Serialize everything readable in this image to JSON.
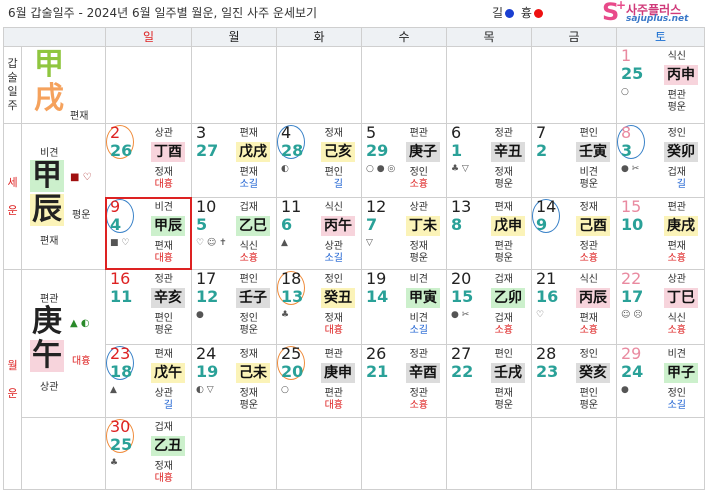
{
  "header": {
    "title": "6월 갑술일주 - 2024년 6월 일주별 월운, 일진 사주 운세보기",
    "legend_good": "길",
    "legend_bad": "흉",
    "logo_name": "사주플러스",
    "logo_url": "sajuplus.net",
    "logo_s": "S",
    "logo_plus": "+"
  },
  "colors": {
    "good": "#1a3fd1",
    "bad": "#e11"
  },
  "weekdays": [
    "일",
    "월",
    "화",
    "수",
    "목",
    "금",
    "토"
  ],
  "side": {
    "ilju_label": [
      "갑",
      "술",
      "일",
      "주"
    ],
    "seun_label": [
      "세",
      "운"
    ],
    "wolun_label": [
      "월",
      "운"
    ]
  },
  "ilju": {
    "top": "甲",
    "bottom": "戌",
    "tg": "편재"
  },
  "seun": {
    "tg_top": "비견",
    "top": "甲",
    "bottom": "辰",
    "tg_bottom": "편재",
    "note": "평운",
    "icons": "■ ♡"
  },
  "wolun": {
    "tg_top": "편관",
    "top": "庚",
    "bottom": "午",
    "tg_bottom": "상관",
    "note": "대흉",
    "icons": "▲ ◐"
  },
  "days": [
    {
      "d": "1",
      "l": "25",
      "t1": "식신",
      "g": "丙申",
      "gc": "pink",
      "t2": "편관",
      "f": "평운",
      "fc": "ok",
      "dc": "pink",
      "s": "○"
    },
    {
      "d": "2",
      "l": "26",
      "t1": "상관",
      "g": "丁酉",
      "gc": "pink",
      "t2": "정재",
      "f": "대흉",
      "fc": "bad",
      "dc": "red",
      "s": "",
      "c": "orange"
    },
    {
      "d": "3",
      "l": "27",
      "t1": "편재",
      "g": "戊戌",
      "gc": "yellow",
      "t2": "편재",
      "f": "소길",
      "fc": "good",
      "dc": "",
      "s": ""
    },
    {
      "d": "4",
      "l": "28",
      "t1": "정재",
      "g": "己亥",
      "gc": "yellow",
      "t2": "편인",
      "f": "길",
      "fc": "good",
      "dc": "",
      "s": "◐",
      "c": "blue"
    },
    {
      "d": "5",
      "l": "29",
      "t1": "편관",
      "g": "庚子",
      "gc": "gray",
      "t2": "정인",
      "f": "소흉",
      "fc": "bad",
      "dc": "",
      "s": "○ ● ◎"
    },
    {
      "d": "6",
      "l": "1",
      "t1": "정관",
      "g": "辛丑",
      "gc": "gray",
      "t2": "정재",
      "f": "평운",
      "fc": "ok",
      "dc": "",
      "s": "♣ ▽"
    },
    {
      "d": "7",
      "l": "2",
      "t1": "편인",
      "g": "壬寅",
      "gc": "gray",
      "t2": "비견",
      "f": "평운",
      "fc": "ok",
      "dc": "",
      "s": ""
    },
    {
      "d": "8",
      "l": "3",
      "t1": "정인",
      "g": "癸卯",
      "gc": "gray",
      "t2": "겁재",
      "f": "길",
      "fc": "good",
      "dc": "pink",
      "s": "● ✂",
      "c": "blue"
    },
    {
      "d": "9",
      "l": "4",
      "t1": "비견",
      "g": "甲辰",
      "gc": "green",
      "t2": "편재",
      "f": "대흉",
      "fc": "bad",
      "dc": "red",
      "s": "■ ♡",
      "c": "blue",
      "today": true
    },
    {
      "d": "10",
      "l": "5",
      "t1": "겁재",
      "g": "乙巳",
      "gc": "green",
      "t2": "식신",
      "f": "소흉",
      "fc": "bad",
      "dc": "",
      "s": "♡ ☺ ✝"
    },
    {
      "d": "11",
      "l": "6",
      "t1": "식신",
      "g": "丙午",
      "gc": "pink",
      "t2": "상관",
      "f": "소길",
      "fc": "good",
      "dc": "",
      "s": "▲"
    },
    {
      "d": "12",
      "l": "7",
      "t1": "상관",
      "g": "丁未",
      "gc": "yellow",
      "t2": "정재",
      "f": "평운",
      "fc": "ok",
      "dc": "",
      "s": "▽"
    },
    {
      "d": "13",
      "l": "8",
      "t1": "편재",
      "g": "戊申",
      "gc": "yellow",
      "t2": "편관",
      "f": "평운",
      "fc": "ok",
      "dc": "",
      "s": ""
    },
    {
      "d": "14",
      "l": "9",
      "t1": "정재",
      "g": "己酉",
      "gc": "yellow",
      "t2": "정관",
      "f": "소흉",
      "fc": "bad",
      "dc": "",
      "s": "",
      "c": "blue"
    },
    {
      "d": "15",
      "l": "10",
      "t1": "편관",
      "g": "庚戌",
      "gc": "yellow",
      "t2": "편재",
      "f": "소흉",
      "fc": "bad",
      "dc": "pink",
      "s": ""
    },
    {
      "d": "16",
      "l": "11",
      "t1": "정관",
      "g": "辛亥",
      "gc": "gray",
      "t2": "편인",
      "f": "평운",
      "fc": "ok",
      "dc": "red",
      "s": ""
    },
    {
      "d": "17",
      "l": "12",
      "t1": "편인",
      "g": "壬子",
      "gc": "gray",
      "t2": "정인",
      "f": "평운",
      "fc": "ok",
      "dc": "",
      "s": "●"
    },
    {
      "d": "18",
      "l": "13",
      "t1": "정인",
      "g": "癸丑",
      "gc": "yellow",
      "t2": "정재",
      "f": "대흉",
      "fc": "bad",
      "dc": "",
      "s": "♣",
      "c": "orange"
    },
    {
      "d": "19",
      "l": "14",
      "t1": "비견",
      "g": "甲寅",
      "gc": "green",
      "t2": "비견",
      "f": "소길",
      "fc": "good",
      "dc": "",
      "s": ""
    },
    {
      "d": "20",
      "l": "15",
      "t1": "겁재",
      "g": "乙卯",
      "gc": "green",
      "t2": "겁재",
      "f": "소흉",
      "fc": "bad",
      "dc": "",
      "s": "● ✂"
    },
    {
      "d": "21",
      "l": "16",
      "t1": "식신",
      "g": "丙辰",
      "gc": "pink",
      "t2": "편재",
      "f": "소흉",
      "fc": "bad",
      "dc": "",
      "s": "♡"
    },
    {
      "d": "22",
      "l": "17",
      "t1": "상관",
      "g": "丁巳",
      "gc": "pink",
      "t2": "식신",
      "f": "소흉",
      "fc": "bad",
      "dc": "pink",
      "s": "☺ ☹"
    },
    {
      "d": "23",
      "l": "18",
      "t1": "편재",
      "g": "戊午",
      "gc": "yellow",
      "t2": "상관",
      "f": "길",
      "fc": "good",
      "dc": "red",
      "s": "▲",
      "c": "blue"
    },
    {
      "d": "24",
      "l": "19",
      "t1": "정재",
      "g": "己未",
      "gc": "yellow",
      "t2": "정재",
      "f": "평운",
      "fc": "ok",
      "dc": "",
      "s": "◐ ▽"
    },
    {
      "d": "25",
      "l": "20",
      "t1": "편관",
      "g": "庚申",
      "gc": "gray",
      "t2": "편관",
      "f": "대흉",
      "fc": "bad",
      "dc": "",
      "s": "○",
      "c": "orange"
    },
    {
      "d": "26",
      "l": "21",
      "t1": "정관",
      "g": "辛酉",
      "gc": "gray",
      "t2": "정관",
      "f": "소흉",
      "fc": "bad",
      "dc": "",
      "s": ""
    },
    {
      "d": "27",
      "l": "22",
      "t1": "편인",
      "g": "壬戌",
      "gc": "gray",
      "t2": "편재",
      "f": "평운",
      "fc": "ok",
      "dc": "",
      "s": ""
    },
    {
      "d": "28",
      "l": "23",
      "t1": "정인",
      "g": "癸亥",
      "gc": "gray",
      "t2": "편인",
      "f": "평운",
      "fc": "ok",
      "dc": "",
      "s": ""
    },
    {
      "d": "29",
      "l": "24",
      "t1": "비견",
      "g": "甲子",
      "gc": "green",
      "t2": "정인",
      "f": "소길",
      "fc": "good",
      "dc": "pink",
      "s": "●"
    },
    {
      "d": "30",
      "l": "25",
      "t1": "겁재",
      "g": "乙丑",
      "gc": "green",
      "t2": "정재",
      "f": "대흉",
      "fc": "bad",
      "dc": "red",
      "s": "♣",
      "c": "orange"
    }
  ]
}
